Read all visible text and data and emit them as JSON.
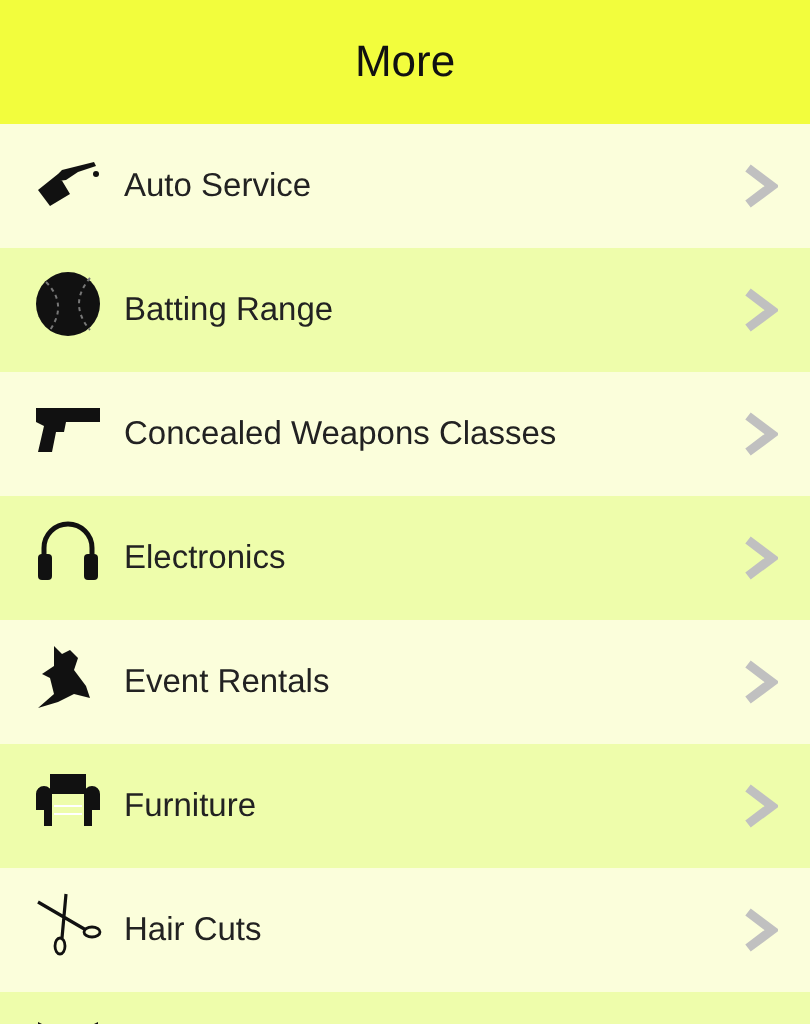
{
  "header": {
    "title": "More"
  },
  "items": [
    {
      "kind": "auto",
      "label": "Auto Service"
    },
    {
      "kind": "ball",
      "label": "Batting Range"
    },
    {
      "kind": "gun",
      "label": "Concealed Weapons Classes"
    },
    {
      "kind": "headphones",
      "label": "Electronics"
    },
    {
      "kind": "dancers",
      "label": "Event Rentals"
    },
    {
      "kind": "armchair",
      "label": "Furniture"
    },
    {
      "kind": "scissors",
      "label": "Hair Cuts"
    },
    {
      "kind": "bowtie"
    }
  ]
}
